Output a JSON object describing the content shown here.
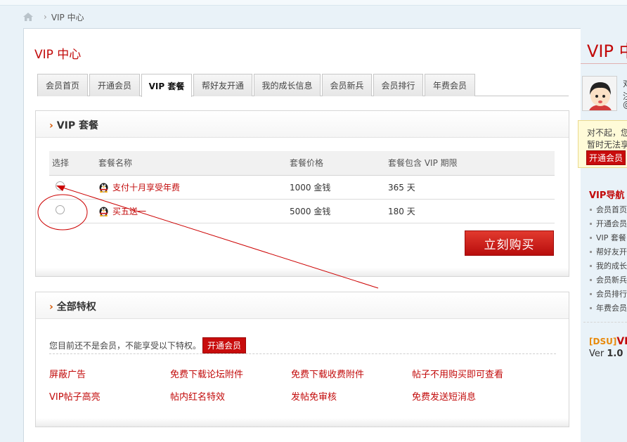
{
  "breadcrumb": {
    "current": "VIP 中心",
    "separator": "›"
  },
  "page": {
    "title": "VIP 中心"
  },
  "tabs": [
    {
      "label": "会员首页"
    },
    {
      "label": "开通会员"
    },
    {
      "label": "VIP 套餐",
      "active": true
    },
    {
      "label": "帮好友开通"
    },
    {
      "label": "我的成长信息"
    },
    {
      "label": "会员新兵"
    },
    {
      "label": "会员排行"
    },
    {
      "label": "年费会员"
    }
  ],
  "packages_panel": {
    "title": "VIP 套餐",
    "columns": [
      "选择",
      "套餐名称",
      "套餐价格",
      "套餐包含 VIP 期限"
    ],
    "rows": [
      {
        "name": "支付十月享受年费",
        "price": "1000 金钱",
        "term": "365 天"
      },
      {
        "name": "买五送一",
        "price": "5000 金钱",
        "term": "180 天"
      }
    ],
    "buy_label": "立刻购买"
  },
  "privileges_panel": {
    "title": "全部特权",
    "notice": "您目前还不是会员，不能享受以下特权。",
    "open_label": "开通会员",
    "items": [
      "屏蔽广告",
      "免费下载论坛附件",
      "免费下载收费附件",
      "帖子不用购买即可查看",
      "VIP帖子高亮",
      "帖内红名特效",
      "发帖免审核",
      "免费发送短消息"
    ]
  },
  "sidebar": {
    "title": "VIP 中心",
    "user_line1": "对",
    "user_line2": "注",
    "user_line3": "@",
    "warn_line1": "对不起，您",
    "warn_line2": "暂时无法享",
    "open_label": "开通会员",
    "nav_title": "VIP导航",
    "nav_items": [
      "会员首页",
      "开通会员",
      "VIP 套餐",
      "帮好友开通",
      "我的成长",
      "会员新兵",
      "会员排行",
      "年费会员"
    ],
    "plugin_tag": "[DSU]",
    "plugin_name": "VIP",
    "version_label": "Ver",
    "version_value": "1.0"
  },
  "colors": {
    "accent": "#c20a0a",
    "annotation": "#cc0000"
  }
}
